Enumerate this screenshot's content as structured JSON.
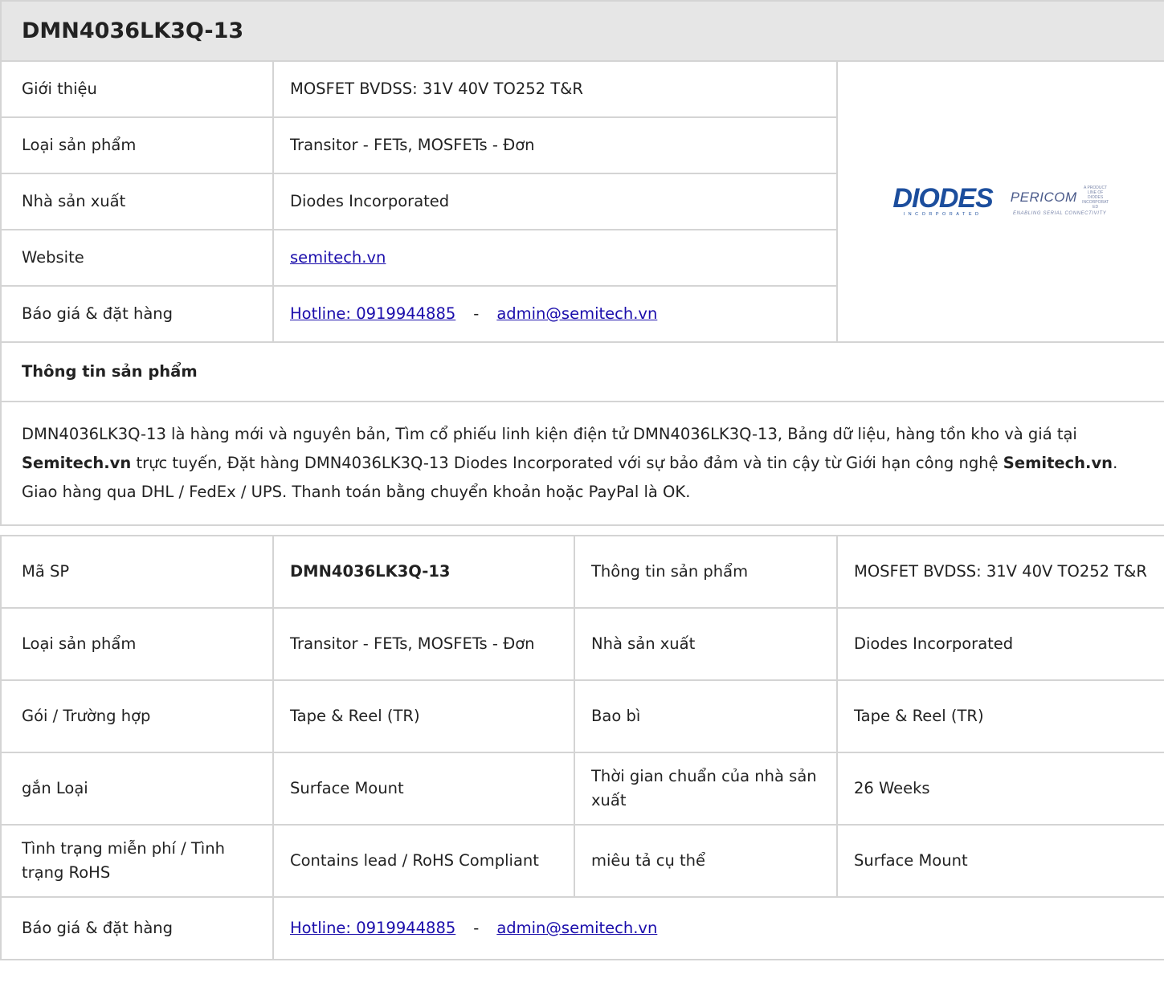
{
  "title": "DMN4036LK3Q-13",
  "summary": {
    "rows": [
      {
        "label": "Giới thiệu",
        "value": "MOSFET BVDSS: 31V 40V TO252 T&R"
      },
      {
        "label": "Loại sản phẩm",
        "value": "Transitor - FETs, MOSFETs - Đơn"
      },
      {
        "label": "Nhà sản xuất",
        "value": "Diodes Incorporated"
      },
      {
        "label": "Website",
        "value": "semitech.vn"
      },
      {
        "label": "Báo giá & đặt hàng",
        "hotline": "Hotline: 0919944885",
        "separator": "-",
        "email": "admin@semitech.vn"
      }
    ]
  },
  "logo": {
    "brand1": "DIODES",
    "brand1_sub": "INCORPORATED",
    "brand2": "PERICOM",
    "brand2_note": "A PRODUCT LINE OF DIODES INCORPORATED",
    "brand2_tag": "ENABLING SERIAL CONNECTIVITY",
    "brand_color": "#1c4e9d"
  },
  "section_title": "Thông tin sản phẩm",
  "description": {
    "p1": "DMN4036LK3Q-13 là hàng mới và nguyên bản, Tìm cổ phiếu linh kiện điện tử DMN4036LK3Q-13, Bảng dữ liệu, hàng tồn kho và giá tại ",
    "b1": "Semitech.vn",
    "p2": " trực tuyến, Đặt hàng DMN4036LK3Q-13 Diodes Incorporated với sự bảo đảm và tin cậy từ Giới hạn công nghệ ",
    "b2": "Semitech.vn",
    "p3": ". Giao hàng qua DHL / FedEx / UPS. Thanh toán bằng chuyển khoản hoặc PayPal là OK."
  },
  "specs": {
    "rows": [
      {
        "l1": "Mã SP",
        "v1": "DMN4036LK3Q-13",
        "l2": "Thông tin sản phẩm",
        "v2": "MOSFET BVDSS: 31V 40V TO252 T&R"
      },
      {
        "l1": "Loại sản phẩm",
        "v1": "Transitor - FETs, MOSFETs - Đơn",
        "l2": "Nhà sản xuất",
        "v2": "Diodes Incorporated"
      },
      {
        "l1": "Gói / Trường hợp",
        "v1": "Tape & Reel (TR)",
        "l2": "Bao bì",
        "v2": "Tape & Reel (TR)"
      },
      {
        "l1": "gắn Loại",
        "v1": "Surface Mount",
        "l2": "Thời gian chuẩn của nhà sản xuất",
        "v2": "26 Weeks"
      },
      {
        "l1": "Tình trạng miễn phí / Tình trạng RoHS",
        "v1": "Contains lead / RoHS Compliant",
        "l2": "miêu tả cụ thể",
        "v2": "Surface Mount"
      }
    ],
    "order": {
      "label": "Báo giá & đặt hàng",
      "hotline": "Hotline: 0919944885",
      "separator": "-",
      "email": "admin@semitech.vn"
    }
  },
  "colors": {
    "header_bg": "#e6e6e6",
    "border": "#d4d4d4",
    "link": "#1a0dab"
  }
}
